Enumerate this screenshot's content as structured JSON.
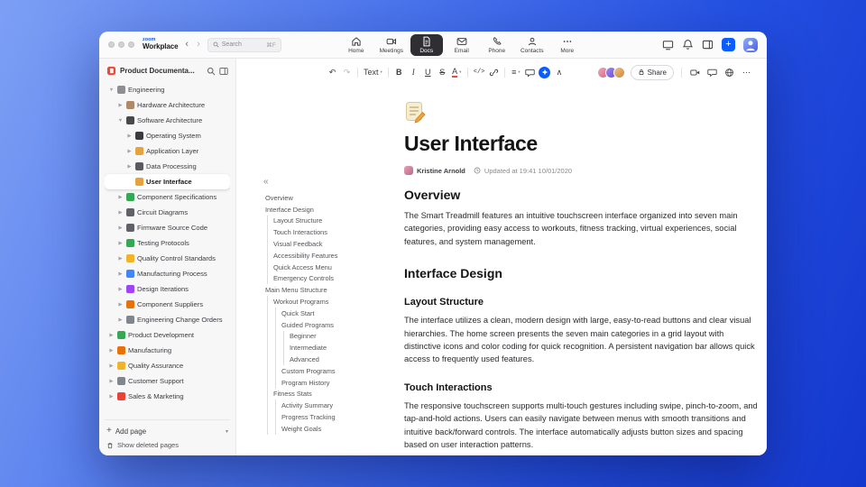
{
  "topbar": {
    "brand": {
      "zoom": "zoom",
      "workplace": "Workplace"
    },
    "search": {
      "placeholder": "Search",
      "shortcut": "⌘F"
    },
    "tabs": [
      {
        "id": "home",
        "label": "Home",
        "active": false
      },
      {
        "id": "meetings",
        "label": "Meetings",
        "active": false
      },
      {
        "id": "docs",
        "label": "Docs",
        "active": true
      },
      {
        "id": "email",
        "label": "Email",
        "active": false
      },
      {
        "id": "phone",
        "label": "Phone",
        "active": false
      },
      {
        "id": "contacts",
        "label": "Contacts",
        "active": false
      },
      {
        "id": "more",
        "label": "More",
        "active": false
      }
    ]
  },
  "sidebar": {
    "title": "Product Documenta...",
    "tree": [
      {
        "label": "Engineering",
        "icon": "gear",
        "icon_color": "#8e8e93",
        "depth": 0,
        "chevron": "expanded",
        "selected": false
      },
      {
        "label": "Hardware Architecture",
        "icon": "ruler",
        "icon_color": "#b08968",
        "depth": 1,
        "chevron": "collapsed",
        "selected": false
      },
      {
        "label": "Software Architecture",
        "icon": "laptop",
        "icon_color": "#48484d",
        "depth": 1,
        "chevron": "expanded",
        "selected": false
      },
      {
        "label": "Operating System",
        "icon": "smartphone",
        "icon_color": "#3a3a3f",
        "depth": 2,
        "chevron": "collapsed",
        "selected": false
      },
      {
        "label": "Application Layer",
        "icon": "package",
        "icon_color": "#e6a23c",
        "depth": 2,
        "chevron": "collapsed",
        "selected": false
      },
      {
        "label": "Data Processing",
        "icon": "chart",
        "icon_color": "#5a5a60",
        "depth": 2,
        "chevron": "collapsed",
        "selected": false
      },
      {
        "label": "User Interface",
        "icon": "pencil",
        "icon_color": "#e6a23c",
        "depth": 2,
        "chevron": "none",
        "selected": true
      },
      {
        "label": "Component Specifications",
        "icon": "clipboard",
        "icon_color": "#34a853",
        "depth": 1,
        "chevron": "collapsed",
        "selected": false
      },
      {
        "label": "Circuit Diagrams",
        "icon": "circuit",
        "icon_color": "#5f6368",
        "depth": 1,
        "chevron": "collapsed",
        "selected": false
      },
      {
        "label": "Firmware Source Code",
        "icon": "floppy-disk",
        "icon_color": "#5f6368",
        "depth": 1,
        "chevron": "collapsed",
        "selected": false
      },
      {
        "label": "Testing Protocols",
        "icon": "test-tube",
        "icon_color": "#34a853",
        "depth": 1,
        "chevron": "collapsed",
        "selected": false
      },
      {
        "label": "Quality Control Standards",
        "icon": "badge-check",
        "icon_color": "#f0b429",
        "depth": 1,
        "chevron": "collapsed",
        "selected": false
      },
      {
        "label": "Manufacturing Process",
        "icon": "factory",
        "icon_color": "#4285f4",
        "depth": 1,
        "chevron": "collapsed",
        "selected": false
      },
      {
        "label": "Design Iterations",
        "icon": "compass",
        "icon_color": "#a142f4",
        "depth": 1,
        "chevron": "collapsed",
        "selected": false
      },
      {
        "label": "Component Suppliers",
        "icon": "truck",
        "icon_color": "#e8710a",
        "depth": 1,
        "chevron": "collapsed",
        "selected": false
      },
      {
        "label": "Engineering Change Orders",
        "icon": "document",
        "icon_color": "#80868b",
        "depth": 1,
        "chevron": "collapsed",
        "selected": false
      },
      {
        "label": "Product Development",
        "icon": "rocket",
        "icon_color": "#34a853",
        "depth": 0,
        "chevron": "collapsed",
        "selected": false
      },
      {
        "label": "Manufacturing",
        "icon": "factory",
        "icon_color": "#e8710a",
        "depth": 0,
        "chevron": "collapsed",
        "selected": false
      },
      {
        "label": "Quality Assurance",
        "icon": "medal",
        "icon_color": "#f0b429",
        "depth": 0,
        "chevron": "collapsed",
        "selected": false
      },
      {
        "label": "Customer Support",
        "icon": "chat",
        "icon_color": "#80868b",
        "depth": 0,
        "chevron": "collapsed",
        "selected": false
      },
      {
        "label": "Sales & Marketing",
        "icon": "megaphone",
        "icon_color": "#ea4335",
        "depth": 0,
        "chevron": "collapsed",
        "selected": false
      }
    ],
    "add_page_label": "Add page",
    "show_deleted_label": "Show deleted pages"
  },
  "outline": {
    "items": [
      {
        "label": "Overview",
        "depth": 0
      },
      {
        "label": "Interface Design",
        "depth": 0
      },
      {
        "label": "Layout Structure",
        "depth": 1
      },
      {
        "label": "Touch Interactions",
        "depth": 1
      },
      {
        "label": "Visual Feedback",
        "depth": 1
      },
      {
        "label": "Accessibility Features",
        "depth": 1
      },
      {
        "label": "Quick Access Menu",
        "depth": 1
      },
      {
        "label": "Emergency Controls",
        "depth": 1
      },
      {
        "label": "Main Menu Structure",
        "depth": 0
      },
      {
        "label": "Workout Programs",
        "depth": 1
      },
      {
        "label": "Quick Start",
        "depth": 2
      },
      {
        "label": "Guided Programs",
        "depth": 2
      },
      {
        "label": "Beginner",
        "depth": 3
      },
      {
        "label": "Intermediate",
        "depth": 3
      },
      {
        "label": "Advanced",
        "depth": 3
      },
      {
        "label": "Custom Programs",
        "depth": 2
      },
      {
        "label": "Program History",
        "depth": 2
      },
      {
        "label": "Fitness Stats",
        "depth": 1
      },
      {
        "label": "Activity Summary",
        "depth": 2
      },
      {
        "label": "Progress Tracking",
        "depth": 2
      },
      {
        "label": "Weight Goals",
        "depth": 2
      }
    ]
  },
  "toolbar": {
    "text_style_label": "Text",
    "share_label": "Share",
    "icons": {
      "undo": "↶",
      "redo": "↷",
      "bold": "B",
      "italic": "I",
      "underline": "U",
      "strikethrough": "S",
      "text_color": "A",
      "code": "</>",
      "list": "≡",
      "collapse": "∧",
      "more": "⋯",
      "dropdown": "▾"
    }
  },
  "doc": {
    "title": "User Interface",
    "author": "Kristine Arnold",
    "updated": "Updated at 19:41 10/01/2020",
    "sections": [
      {
        "type": "h2",
        "text": "Overview"
      },
      {
        "type": "p",
        "text": "The Smart Treadmill features an intuitive touchscreen interface organized into seven main categories, providing easy access to workouts, fitness tracking, virtual experiences, social features, and system management."
      },
      {
        "type": "h2",
        "text": "Interface Design"
      },
      {
        "type": "h3",
        "text": "Layout Structure"
      },
      {
        "type": "p",
        "text": "The interface utilizes a clean, modern design with large, easy-to-read buttons and clear visual hierarchies. The home screen presents the seven main categories in a grid layout with distinctive icons and color coding for quick recognition. A persistent navigation bar allows quick access to frequently used features."
      },
      {
        "type": "h3",
        "text": "Touch Interactions"
      },
      {
        "type": "p",
        "text": "The responsive touchscreen supports multi-touch gestures including swipe, pinch-to-zoom, and tap-and-hold actions. Users can easily navigate between menus with smooth transitions and intuitive back/forward controls. The interface automatically adjusts button sizes and spacing based on user interaction patterns."
      }
    ]
  },
  "misc": {
    "collapse_outline": "«",
    "back": "‹",
    "forward": "›",
    "add": "+",
    "add_chevron": "▾"
  },
  "colors": {
    "accent": "#0b5cff",
    "active_tab_bg": "#2f2f33",
    "selected_row_bg": "#ffffff"
  }
}
